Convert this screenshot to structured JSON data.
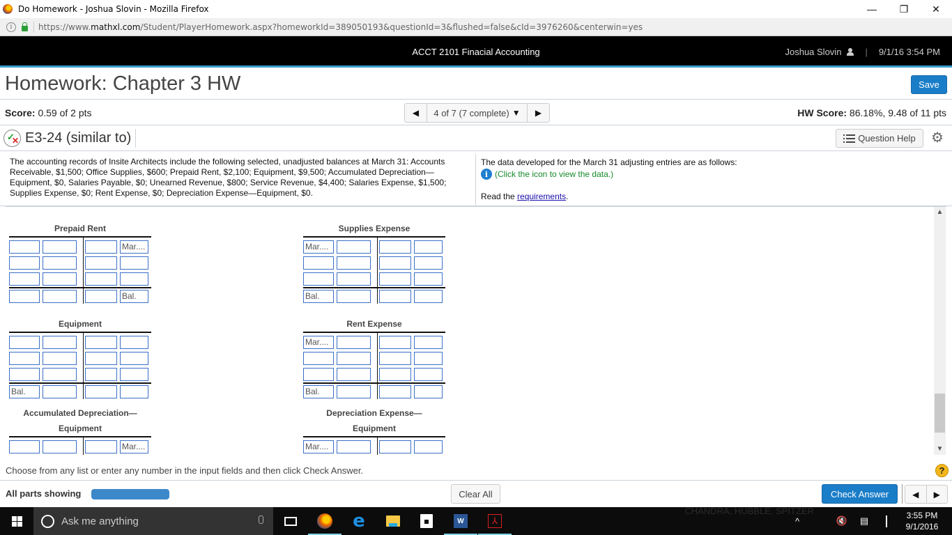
{
  "browser": {
    "window_title": "Do Homework - Joshua Slovin - Mozilla Firefox",
    "window_controls": {
      "minimize": "—",
      "restore": "❐",
      "close": "✕"
    },
    "url_prefix": "https://www.",
    "url_domain": "mathxl.com",
    "url_rest": "/Student/PlayerHomework.aspx?homeworkId=389050193&questionId=3&flushed=false&cId=3976260&centerwin=yes"
  },
  "topnav": {
    "course": "ACCT 2101 Finacial Accounting",
    "user": "Joshua Slovin",
    "separator": "|",
    "datetime": "9/1/16 3:54 PM"
  },
  "homework": {
    "title": "Homework: Chapter 3 HW",
    "save_label": "Save",
    "score_label": "Score:",
    "score_value": " 0.59 of 2 pts",
    "question_nav": {
      "prev": "◀",
      "label": "4 of 7 (7 complete)",
      "dropdown": "▼",
      "next": "▶"
    },
    "hw_score_label": "HW Score:",
    "hw_score_value": " 86.18%, 9.48 of 11 pts"
  },
  "question": {
    "id": "E3-24 (similar to)",
    "status_icon": {
      "check": "✓",
      "x": "✕"
    },
    "help_label": "Question Help",
    "settings_icon": "⚙"
  },
  "problem": {
    "left_text": "The accounting records of Insite Architects include the following selected, unadjusted balances at March 31: Accounts Receivable, $1,500; Office Supplies, $600; Prepaid Rent, $2,100; Equipment, $9,500; Accumulated Depreciation—Equipment, $0, Salaries Payable, $0; Unearned Revenue, $800; Service Revenue, $4,400; Salaries Expense, $1,500; Supplies Expense, $0; Rent Expense, $0; Depreciation Expense—Equipment, $0.",
    "right_text": "The data developed for the March 31 adjusting entries are as follows:",
    "info_icon": "i",
    "click_text": "(Click the icon to view the data.)",
    "read_prefix": "Read the ",
    "read_link": "requirements",
    "read_suffix": "."
  },
  "t_accounts": [
    {
      "name": "Prepaid Rent",
      "rows": [
        [
          "",
          "",
          "",
          "Mar...."
        ],
        [
          "",
          "",
          "",
          ""
        ],
        [
          "",
          "",
          "",
          ""
        ]
      ],
      "bal": [
        "",
        "",
        "",
        "Bal."
      ]
    },
    {
      "name": "Supplies Expense",
      "rows": [
        [
          "Mar....",
          "",
          "",
          ""
        ],
        [
          "",
          "",
          "",
          ""
        ],
        [
          "",
          "",
          "",
          ""
        ]
      ],
      "bal": [
        "Bal.",
        "",
        "",
        ""
      ]
    },
    {
      "name": "Equipment",
      "rows": [
        [
          "",
          "",
          "",
          ""
        ],
        [
          "",
          "",
          "",
          ""
        ],
        [
          "",
          "",
          "",
          ""
        ]
      ],
      "bal": [
        "Bal.",
        "",
        "",
        ""
      ]
    },
    {
      "name": "Rent Expense",
      "rows": [
        [
          "Mar....",
          "",
          "",
          ""
        ],
        [
          "",
          "",
          "",
          ""
        ],
        [
          "",
          "",
          "",
          ""
        ]
      ],
      "bal": [
        "Bal.",
        "",
        "",
        ""
      ]
    },
    {
      "name_line1": "Accumulated Depreciation—",
      "name_line2": "Equipment",
      "rows": [
        [
          "",
          "",
          "",
          "Mar...."
        ]
      ]
    },
    {
      "name_line1": "Depreciation Expense—",
      "name_line2": "Equipment",
      "rows": [
        [
          "Mar....",
          "",
          "",
          ""
        ]
      ]
    }
  ],
  "scroll": {
    "up": "▲",
    "down": "▼"
  },
  "footer": {
    "instructions": "Choose from any list or enter any number in the input fields and then click Check Answer.",
    "help_icon": "?",
    "all_parts": "All parts showing",
    "progress_percent": 100,
    "clear_all": "Clear All",
    "check_answer": "Check Answer",
    "prev": "◀",
    "next": "▶"
  },
  "taskbar": {
    "search_placeholder": "Ask me anything",
    "edge_glyph": "e",
    "word_glyph": "W",
    "pdf_glyph": "⅄",
    "wallpaper_caption": "CHANDRA, HUBBLE, SPITZER",
    "tray_chevron": "^",
    "volume": "🔇",
    "notification": "▤",
    "time": "3:55 PM",
    "date": "9/1/2016"
  }
}
